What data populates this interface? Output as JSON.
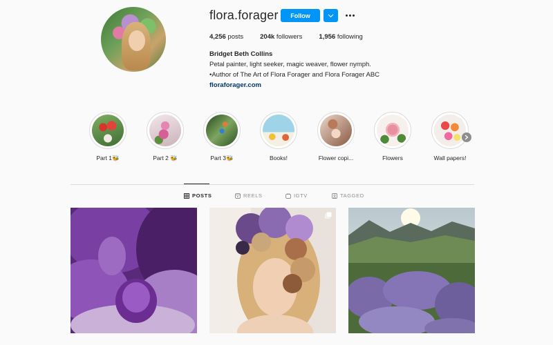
{
  "profile": {
    "username": "flora.forager",
    "follow_label": "Follow",
    "posts_count": "4,256",
    "posts_label": " posts",
    "followers_count": "204k",
    "followers_label": " followers",
    "following_count": "1,956",
    "following_label": " following",
    "full_name": "Bridget Beth Collins",
    "bio_line1": "Petal painter, light seeker, magic weaver, flower nymph.",
    "bio_line2": "•Author of The Art of Flora Forager and Flora Forager ABC",
    "website": "floraforager.com"
  },
  "highlights": [
    {
      "label": "Part 1🐝"
    },
    {
      "label": "Part 2 🐝"
    },
    {
      "label": "Part 3🐝"
    },
    {
      "label": "Books!"
    },
    {
      "label": "Flower copi..."
    },
    {
      "label": "Flowers"
    },
    {
      "label": "Wall papers!"
    }
  ],
  "tabs": [
    {
      "label": "POSTS",
      "icon": "grid-icon",
      "active": true
    },
    {
      "label": "REELS",
      "icon": "reels-icon",
      "active": false
    },
    {
      "label": "IGTV",
      "icon": "igtv-icon",
      "active": false
    },
    {
      "label": "TAGGED",
      "icon": "tagged-icon",
      "active": false
    }
  ],
  "colors": {
    "accent": "#0095f6",
    "link": "#00376b",
    "muted": "#8e8e8e"
  }
}
